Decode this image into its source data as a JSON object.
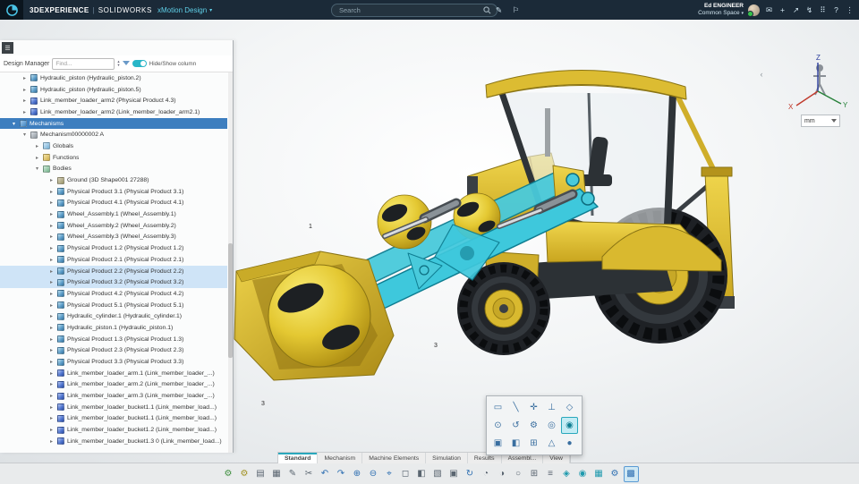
{
  "colors": {
    "accent": "#2aa8bc",
    "selection": "#3d7ebf",
    "highlight": "#3ec8dc",
    "model_yellow": "#d9b92f",
    "presence_green": "#35c24a"
  },
  "header": {
    "brand": "3DEXPERIENCE",
    "separator": "|",
    "product": "SOLIDWORKS",
    "app": "xMotion Design",
    "caret": "▾",
    "search_placeholder": "Search",
    "user_name": "Ed ENGINEER",
    "space": "Common Space",
    "icons": [
      {
        "name": "pencil-icon",
        "glyph": "✎"
      },
      {
        "name": "tag-icon",
        "glyph": "⚐"
      }
    ],
    "right_icons": [
      {
        "name": "chat-icon",
        "glyph": "✉"
      },
      {
        "name": "add-icon",
        "glyph": "+"
      },
      {
        "name": "share-icon",
        "glyph": "↗"
      },
      {
        "name": "flash-icon",
        "glyph": "↯"
      },
      {
        "name": "apps-grid-icon",
        "glyph": "⠿"
      },
      {
        "name": "help-icon",
        "glyph": "?"
      },
      {
        "name": "more-icon",
        "glyph": "⋮"
      }
    ]
  },
  "panel": {
    "menu_glyph": "☰",
    "title": "Design Manager",
    "find_placeholder": "Find...",
    "find_prev": "▴",
    "find_next": "▾",
    "toggle_label": "Hide/Show column",
    "tree": [
      {
        "label": "Hydraulic_piston (Hydraulic_piston.2)",
        "lv": "lv3",
        "icon": "ico-part",
        "arrow": "▸",
        "sel": ""
      },
      {
        "label": "Hydraulic_piston (Hydraulic_piston.5)",
        "lv": "lv3",
        "icon": "ico-part",
        "arrow": "▸",
        "sel": ""
      },
      {
        "label": "Link_member_loader_arm2 (Physical Product 4.3)",
        "lv": "lv3",
        "icon": "ico-link",
        "arrow": "▸",
        "sel": ""
      },
      {
        "label": "Link_member_loader_arm2 (Link_member_loader_arm2.1)",
        "lv": "lv3",
        "icon": "ico-link",
        "arrow": "▸",
        "sel": ""
      },
      {
        "label": "Mechanisms",
        "lv": "lv2",
        "icon": "ico-mechfolder",
        "arrow": "▾",
        "sel": "sel-dark"
      },
      {
        "label": "Mechanism00000002 A",
        "lv": "lv3",
        "icon": "ico-mech",
        "arrow": "▾",
        "sel": ""
      },
      {
        "label": "Globals",
        "lv": "lv4",
        "icon": "ico-globals",
        "arrow": "▸",
        "sel": ""
      },
      {
        "label": "Functions",
        "lv": "lv4",
        "icon": "ico-fn",
        "arrow": "▸",
        "sel": ""
      },
      {
        "label": "Bodies",
        "lv": "lv4",
        "icon": "ico-bodies",
        "arrow": "▾",
        "sel": ""
      },
      {
        "label": "Ground (3D Shape001 27288)",
        "lv": "lv5",
        "icon": "ico-ground",
        "arrow": "▸",
        "sel": ""
      },
      {
        "label": "Physical Product 3.1 (Physical Product 3.1)",
        "lv": "lv5",
        "icon": "ico-part",
        "arrow": "▸",
        "sel": ""
      },
      {
        "label": "Physical Product 4.1 (Physical Product 4.1)",
        "lv": "lv5",
        "icon": "ico-part",
        "arrow": "▸",
        "sel": ""
      },
      {
        "label": "Wheel_Assembly.1 (Wheel_Assembly.1)",
        "lv": "lv5",
        "icon": "ico-part",
        "arrow": "▸",
        "sel": ""
      },
      {
        "label": "Wheel_Assembly.2 (Wheel_Assembly.2)",
        "lv": "lv5",
        "icon": "ico-part",
        "arrow": "▸",
        "sel": ""
      },
      {
        "label": "Wheel_Assembly.3 (Wheel_Assembly.3)",
        "lv": "lv5",
        "icon": "ico-part",
        "arrow": "▸",
        "sel": ""
      },
      {
        "label": "Physical Product 1.2 (Physical Product 1.2)",
        "lv": "lv5",
        "icon": "ico-part",
        "arrow": "▸",
        "sel": ""
      },
      {
        "label": "Physical Product 2.1 (Physical Product 2.1)",
        "lv": "lv5",
        "icon": "ico-part",
        "arrow": "▸",
        "sel": ""
      },
      {
        "label": "Physical Product 2.2 (Physical Product 2.2)",
        "lv": "lv5",
        "icon": "ico-part",
        "arrow": "▸",
        "sel": "sel-light"
      },
      {
        "label": "Physical Product 3.2 (Physical Product 3.2)",
        "lv": "lv5",
        "icon": "ico-part",
        "arrow": "▸",
        "sel": "sel-light"
      },
      {
        "label": "Physical Product 4.2 (Physical Product 4.2)",
        "lv": "lv5",
        "icon": "ico-part",
        "arrow": "▸",
        "sel": ""
      },
      {
        "label": "Physical Product 5.1 (Physical Product 5.1)",
        "lv": "lv5",
        "icon": "ico-part",
        "arrow": "▸",
        "sel": ""
      },
      {
        "label": "Hydraulic_cylinder.1 (Hydraulic_cylinder.1)",
        "lv": "lv5",
        "icon": "ico-part",
        "arrow": "▸",
        "sel": ""
      },
      {
        "label": "Hydraulic_piston.1 (Hydraulic_piston.1)",
        "lv": "lv5",
        "icon": "ico-part",
        "arrow": "▸",
        "sel": ""
      },
      {
        "label": "Physical Product 1.3 (Physical Product 1.3)",
        "lv": "lv5",
        "icon": "ico-part",
        "arrow": "▸",
        "sel": ""
      },
      {
        "label": "Physical Product 2.3 (Physical Product 2.3)",
        "lv": "lv5",
        "icon": "ico-part",
        "arrow": "▸",
        "sel": ""
      },
      {
        "label": "Physical Product 3.3 (Physical Product 3.3)",
        "lv": "lv5",
        "icon": "ico-part",
        "arrow": "▸",
        "sel": ""
      },
      {
        "label": "Link_member_loader_arm.1 (Link_member_loader_...)",
        "lv": "lv5",
        "icon": "ico-link",
        "arrow": "▸",
        "sel": ""
      },
      {
        "label": "Link_member_loader_arm.2 (Link_member_loader_...)",
        "lv": "lv5",
        "icon": "ico-link",
        "arrow": "▸",
        "sel": ""
      },
      {
        "label": "Link_member_loader_arm.3 (Link_member_loader_...)",
        "lv": "lv5",
        "icon": "ico-link",
        "arrow": "▸",
        "sel": ""
      },
      {
        "label": "Link_member_loader_bucket1.1 (Link_member_load...)",
        "lv": "lv5",
        "icon": "ico-link",
        "arrow": "▸",
        "sel": ""
      },
      {
        "label": "Link_member_loader_bucket1.1 (Link_member_load...)",
        "lv": "lv5",
        "icon": "ico-link",
        "arrow": "▸",
        "sel": ""
      },
      {
        "label": "Link_member_loader_bucket1.2 (Link_member_load...)",
        "lv": "lv5",
        "icon": "ico-link",
        "arrow": "▸",
        "sel": ""
      },
      {
        "label": "Link_member_loader_bucket1.3 0 (Link_member_load...)",
        "lv": "lv5",
        "icon": "ico-link",
        "arrow": "▸",
        "sel": ""
      }
    ]
  },
  "viewport": {
    "annotations": [
      "1",
      "3",
      "3"
    ],
    "triad": {
      "x": "X",
      "y": "Y",
      "z": "Z"
    },
    "units": "mm",
    "collapse_glyph": "‹"
  },
  "palette": {
    "tools": [
      {
        "glyph": "▭",
        "name": "palette-tool-rigid",
        "state": ""
      },
      {
        "glyph": "╲",
        "name": "palette-tool-linear",
        "state": ""
      },
      {
        "glyph": "✛",
        "name": "palette-tool-cross",
        "state": ""
      },
      {
        "glyph": "⊥",
        "name": "palette-tool-perpendicular",
        "state": ""
      },
      {
        "glyph": "◇",
        "name": "palette-tool-planar",
        "state": ""
      },
      {
        "glyph": "⊙",
        "name": "palette-tool-revolute",
        "state": ""
      },
      {
        "glyph": "↺",
        "name": "palette-tool-cylindrical",
        "state": ""
      },
      {
        "glyph": "⚙",
        "name": "palette-tool-gear",
        "state": ""
      },
      {
        "glyph": "◎",
        "name": "palette-tool-spherical",
        "state": ""
      },
      {
        "glyph": "◉",
        "name": "palette-tool-ball-joint",
        "state": "on"
      },
      {
        "glyph": "▣",
        "name": "palette-tool-body",
        "state": ""
      },
      {
        "glyph": "◧",
        "name": "palette-tool-face",
        "state": ""
      },
      {
        "glyph": "⊞",
        "name": "palette-tool-grid",
        "state": ""
      },
      {
        "glyph": "△",
        "name": "palette-tool-wedge",
        "state": ""
      },
      {
        "glyph": "●",
        "name": "palette-tool-point",
        "state": ""
      }
    ]
  },
  "tabs": [
    {
      "label": "Standard",
      "state": "on"
    },
    {
      "label": "Mechanism",
      "state": ""
    },
    {
      "label": "Machine Elements",
      "state": ""
    },
    {
      "label": "Simulation",
      "state": ""
    },
    {
      "label": "Results",
      "state": ""
    },
    {
      "label": "Assembl...",
      "state": ""
    },
    {
      "label": "View",
      "state": ""
    }
  ],
  "toolbar": [
    {
      "glyph": "⚙",
      "name": "settings-button",
      "tone": "c-green",
      "state": ""
    },
    {
      "glyph": "⚙",
      "name": "options-button",
      "tone": "c-olive",
      "state": ""
    },
    {
      "glyph": "▤",
      "name": "save-button",
      "tone": "c-slate",
      "state": ""
    },
    {
      "glyph": "▦",
      "name": "table-button",
      "tone": "c-slate",
      "state": ""
    },
    {
      "glyph": "✎",
      "name": "edit-button",
      "tone": "c-slate",
      "state": ""
    },
    {
      "glyph": "✂",
      "name": "cut-button",
      "tone": "c-slate",
      "state": ""
    },
    {
      "glyph": "↶",
      "name": "undo-button",
      "tone": "c-blue",
      "state": ""
    },
    {
      "glyph": "↷",
      "name": "redo-button",
      "tone": "c-blue",
      "state": ""
    },
    {
      "glyph": "⊕",
      "name": "zoom-in-button",
      "tone": "c-blue",
      "state": ""
    },
    {
      "glyph": "⊖",
      "name": "zoom-out-button",
      "tone": "c-blue",
      "state": ""
    },
    {
      "glyph": "⌖",
      "name": "center-view-button",
      "tone": "c-blue",
      "state": ""
    },
    {
      "glyph": "◻",
      "name": "fit-view-button",
      "tone": "c-slate",
      "state": ""
    },
    {
      "glyph": "◧",
      "name": "view-left-button",
      "tone": "c-slate",
      "state": ""
    },
    {
      "glyph": "▧",
      "name": "view-top-button",
      "tone": "c-slate",
      "state": ""
    },
    {
      "glyph": "▣",
      "name": "view-front-button",
      "tone": "c-slate",
      "state": ""
    },
    {
      "glyph": "↻",
      "name": "rotate-view-button",
      "tone": "c-blue",
      "state": ""
    },
    {
      "glyph": "◔",
      "name": "shaded-button",
      "tone": "c-slate",
      "state": ""
    },
    {
      "glyph": "◑",
      "name": "shaded-edges-button",
      "tone": "c-slate",
      "state": ""
    },
    {
      "glyph": "○",
      "name": "wireframe-button",
      "tone": "c-slate",
      "state": ""
    },
    {
      "glyph": "⊞",
      "name": "multi-view-button",
      "tone": "c-slate",
      "state": ""
    },
    {
      "glyph": "≡",
      "name": "list-view-button",
      "tone": "c-slate",
      "state": ""
    },
    {
      "glyph": "◈",
      "name": "render-button",
      "tone": "c-teal",
      "state": ""
    },
    {
      "glyph": "◉",
      "name": "record-button",
      "tone": "c-teal",
      "state": ""
    },
    {
      "glyph": "▦",
      "name": "grid-display-button",
      "tone": "c-teal",
      "state": ""
    },
    {
      "glyph": "⚙",
      "name": "sim-settings-button",
      "tone": "c-blue",
      "state": ""
    },
    {
      "glyph": "▩",
      "name": "section-button",
      "tone": "c-blue",
      "state": "on"
    }
  ]
}
